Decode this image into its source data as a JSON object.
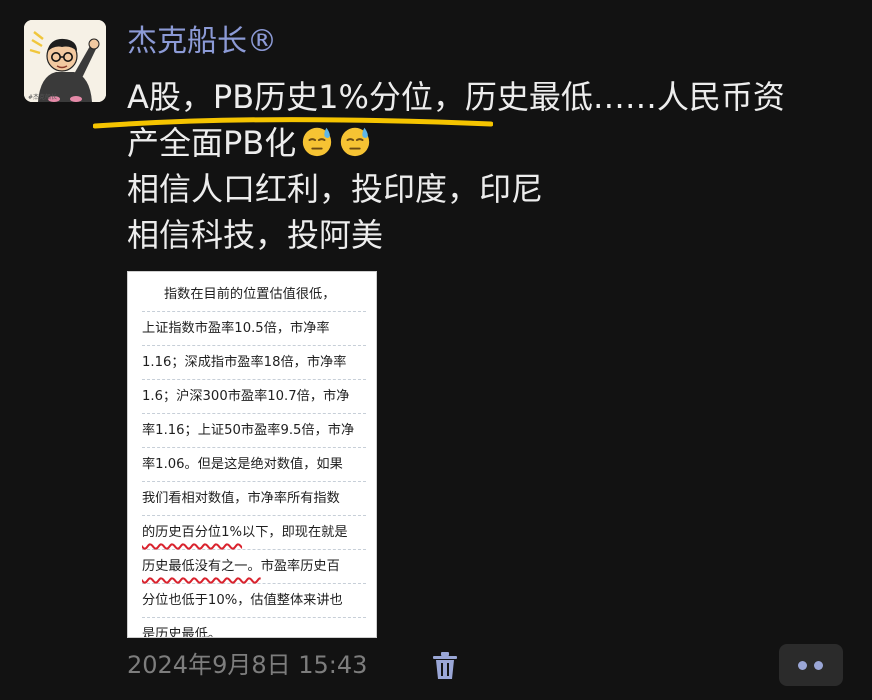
{
  "author": {
    "name": "杰克船长®",
    "avatar_caption": "#杰克船长"
  },
  "post": {
    "highlight_text": "A股，PB历史1%分位",
    "line1_rest": "，历史最低……人民币资",
    "line2": "产全面PB化",
    "emoji": [
      "downcast-face-with-sweat",
      "downcast-face-with-sweat"
    ],
    "line3": "相信人口红利，投印度，印尼",
    "line4": "相信科技，投阿美",
    "highlight_color": "#f5c400"
  },
  "image": {
    "lines": [
      "指数在目前的位置估值很低，",
      "上证指数市盈率10.5倍，市净率",
      "1.16；深成指市盈率18倍，市净率",
      "1.6；沪深300市盈率10.7倍，市净",
      "率1.16；上证50市盈率9.5倍，市净",
      "率1.06。但是这是绝对数值，如果",
      "我们看相对数值，市净率所有指数"
    ],
    "line8_underlined": "的历史百分位1%",
    "line8_rest": "以下，即现在就是",
    "line9_underlined": "历史最低没有之一。",
    "line9_rest": "市盈率历史百",
    "line10": "分位也低于10%，估值整体来讲也",
    "line11": "是历史最低。",
    "underline_color": "#d9232e"
  },
  "footer": {
    "timestamp": "2024年9月8日 15:43",
    "delete_icon": "trash-icon",
    "more_icon": "more-dots-icon"
  }
}
